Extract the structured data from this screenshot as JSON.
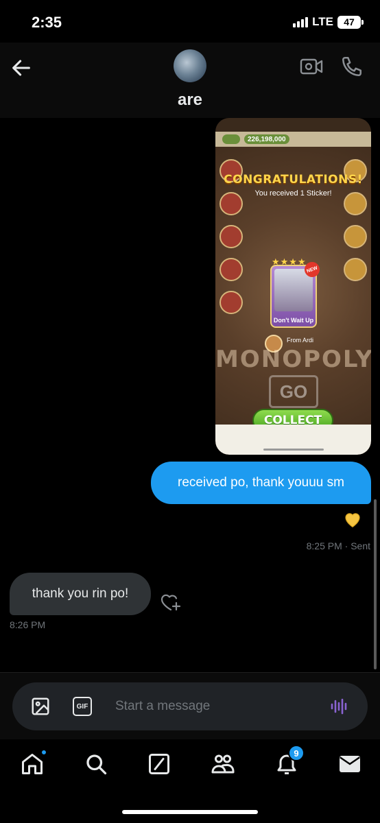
{
  "status_bar": {
    "time": "2:35",
    "network": "LTE",
    "battery": "47"
  },
  "header": {
    "name": "are",
    "back_icon": "back-arrow-icon",
    "video_icon": "video-icon",
    "call_icon": "phone-icon"
  },
  "messages": {
    "image": {
      "balance": "226,198,000",
      "headline": "CONGRATULATIONS!",
      "subtext": "You received 1 Sticker!",
      "sticker_name": "Don't Wait Up",
      "sticker_badge": "NEW",
      "from_label": "From Ardi",
      "board_text": "MONOPOLY",
      "go_text": "GO",
      "button": "COLLECT"
    },
    "outgoing_text": "received po, thank youuu sm",
    "reaction": "yellow-heart",
    "outgoing_meta": "8:25 PM · Sent",
    "incoming_text": "thank you rin po!",
    "incoming_time": "8:26 PM"
  },
  "composer": {
    "placeholder": "Start a message",
    "gif_label": "GIF"
  },
  "nav": {
    "items": [
      "home",
      "search",
      "grok",
      "communities",
      "notifications",
      "messages"
    ],
    "notifications_badge": "9"
  },
  "colors": {
    "accent": "#1d9bf0",
    "incoming_bubble": "#2f3336",
    "background": "#000000",
    "voice": "#8a63d2"
  }
}
